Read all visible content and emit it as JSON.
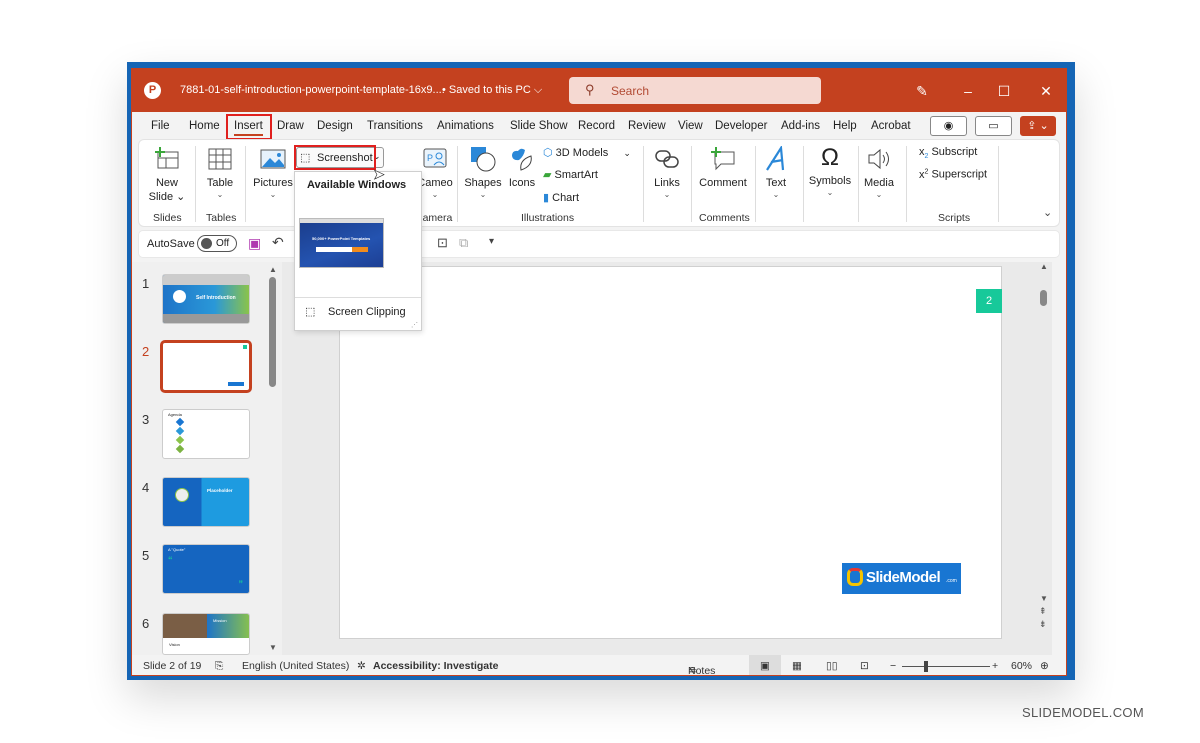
{
  "window": {
    "doc_title": "7881-01-self-introduction-powerpoint-template-16x9....",
    "save_status": "• Saved to this PC",
    "search_placeholder": "Search",
    "app_logo": "P"
  },
  "menu": {
    "tabs": [
      "File",
      "Home",
      "Insert",
      "Draw",
      "Design",
      "Transitions",
      "Animations",
      "Slide Show",
      "Record",
      "Review",
      "View",
      "Developer",
      "Add-ins",
      "Help",
      "Acrobat"
    ],
    "active_tab": "Insert"
  },
  "ribbon": {
    "new_slide": "New",
    "new_slide2": "Slide",
    "table": "Table",
    "pictures": "Pictures",
    "screenshot": "Screenshot",
    "cameo": "Cameo",
    "shapes": "Shapes",
    "icons": "Icons",
    "models3d": "3D Models",
    "smartart": "SmartArt",
    "chart": "Chart",
    "links": "Links",
    "comment": "Comment",
    "text": "Text",
    "symbols": "Symbols",
    "media": "Media",
    "subscript": "Subscript",
    "superscript": "Superscript",
    "groups": {
      "slides": "Slides",
      "tables": "Tables",
      "camera": "Camera",
      "illustrations": "Illustrations",
      "comments": "Comments",
      "scripts": "Scripts"
    }
  },
  "screenshot_menu": {
    "header": "Available Windows",
    "window_thumb_caption": "50,000+ PowerPoint Templates",
    "screen_clipping": "Screen Clipping"
  },
  "qat": {
    "autosave_label": "AutoSave",
    "autosave_state": "Off"
  },
  "slides": {
    "numbers": [
      "1",
      "2",
      "3",
      "4",
      "5",
      "6"
    ],
    "active": "2",
    "thumb1_title": "Self Introduction",
    "thumb3_title": "Agenda",
    "thumb4_title": "Placeholder",
    "thumb5_title": "A \"Quote\"",
    "thumb6_title": "Mission",
    "thumb6_sub": "Vision"
  },
  "slide_canvas": {
    "page_badge": "2",
    "logo_text": "SlideModel",
    "logo_suffix": ".com",
    "badge_color": "#17c99a",
    "logo_bg": "#1976d2"
  },
  "status": {
    "slide_counter": "Slide 2 of 19",
    "language": "English (United States)",
    "accessibility": "Accessibility: Investigate",
    "notes": "Notes",
    "zoom": "60%",
    "zoom_fraction": 0.6
  },
  "watermark": "SLIDEMODEL.COM",
  "colors": {
    "accent": "#c4411f",
    "frame": "#1565b5",
    "highlight": "#e0201e"
  }
}
